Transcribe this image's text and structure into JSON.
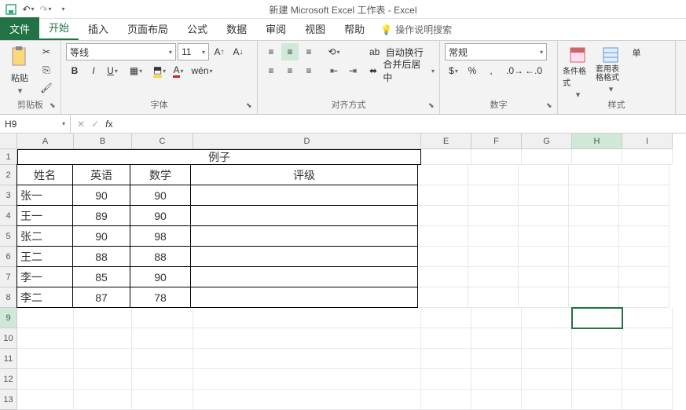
{
  "title": "新建 Microsoft Excel 工作表 - Excel",
  "tabs": {
    "file": "文件",
    "home": "开始",
    "insert": "插入",
    "layout": "页面布局",
    "formulas": "公式",
    "data": "数据",
    "review": "审阅",
    "view": "视图",
    "help": "帮助",
    "tellme": "操作说明搜索"
  },
  "ribbon": {
    "clipboard": {
      "label": "剪贴板",
      "paste": "粘贴"
    },
    "font": {
      "label": "字体",
      "name": "等线",
      "size": "11",
      "pinyin": "wén"
    },
    "alignment": {
      "label": "对齐方式",
      "wrap": "自动换行",
      "merge": "合并后居中"
    },
    "number": {
      "label": "数字",
      "format": "常规"
    },
    "styles": {
      "label": "样式",
      "conditional": "条件格式",
      "table": "套用表格格式",
      "cell_prefix": "单"
    }
  },
  "namebox": "H9",
  "columns": [
    "A",
    "B",
    "C",
    "D",
    "E",
    "F",
    "G",
    "H",
    "I"
  ],
  "rows": [
    "1",
    "2",
    "3",
    "4",
    "5",
    "6",
    "7",
    "8",
    "9",
    "10",
    "11",
    "12",
    "13"
  ],
  "sheet": {
    "title_row": "例子",
    "headers": {
      "name": "姓名",
      "english": "英语",
      "math": "数学",
      "grade": "评级"
    },
    "data": [
      {
        "name": "张一",
        "english": "90",
        "math": "90"
      },
      {
        "name": "王一",
        "english": "89",
        "math": "90"
      },
      {
        "name": "张二",
        "english": "90",
        "math": "98"
      },
      {
        "name": "王二",
        "english": "88",
        "math": "88"
      },
      {
        "name": "李一",
        "english": "85",
        "math": "90"
      },
      {
        "name": "李二",
        "english": "87",
        "math": "78"
      }
    ]
  },
  "selected": {
    "row": "9",
    "col": "H"
  },
  "chart_data": {
    "type": "table",
    "title": "例子",
    "columns": [
      "姓名",
      "英语",
      "数学",
      "评级"
    ],
    "rows": [
      [
        "张一",
        90,
        90,
        ""
      ],
      [
        "王一",
        89,
        90,
        ""
      ],
      [
        "张二",
        90,
        98,
        ""
      ],
      [
        "王二",
        88,
        88,
        ""
      ],
      [
        "李一",
        85,
        90,
        ""
      ],
      [
        "李二",
        87,
        78,
        ""
      ]
    ]
  }
}
